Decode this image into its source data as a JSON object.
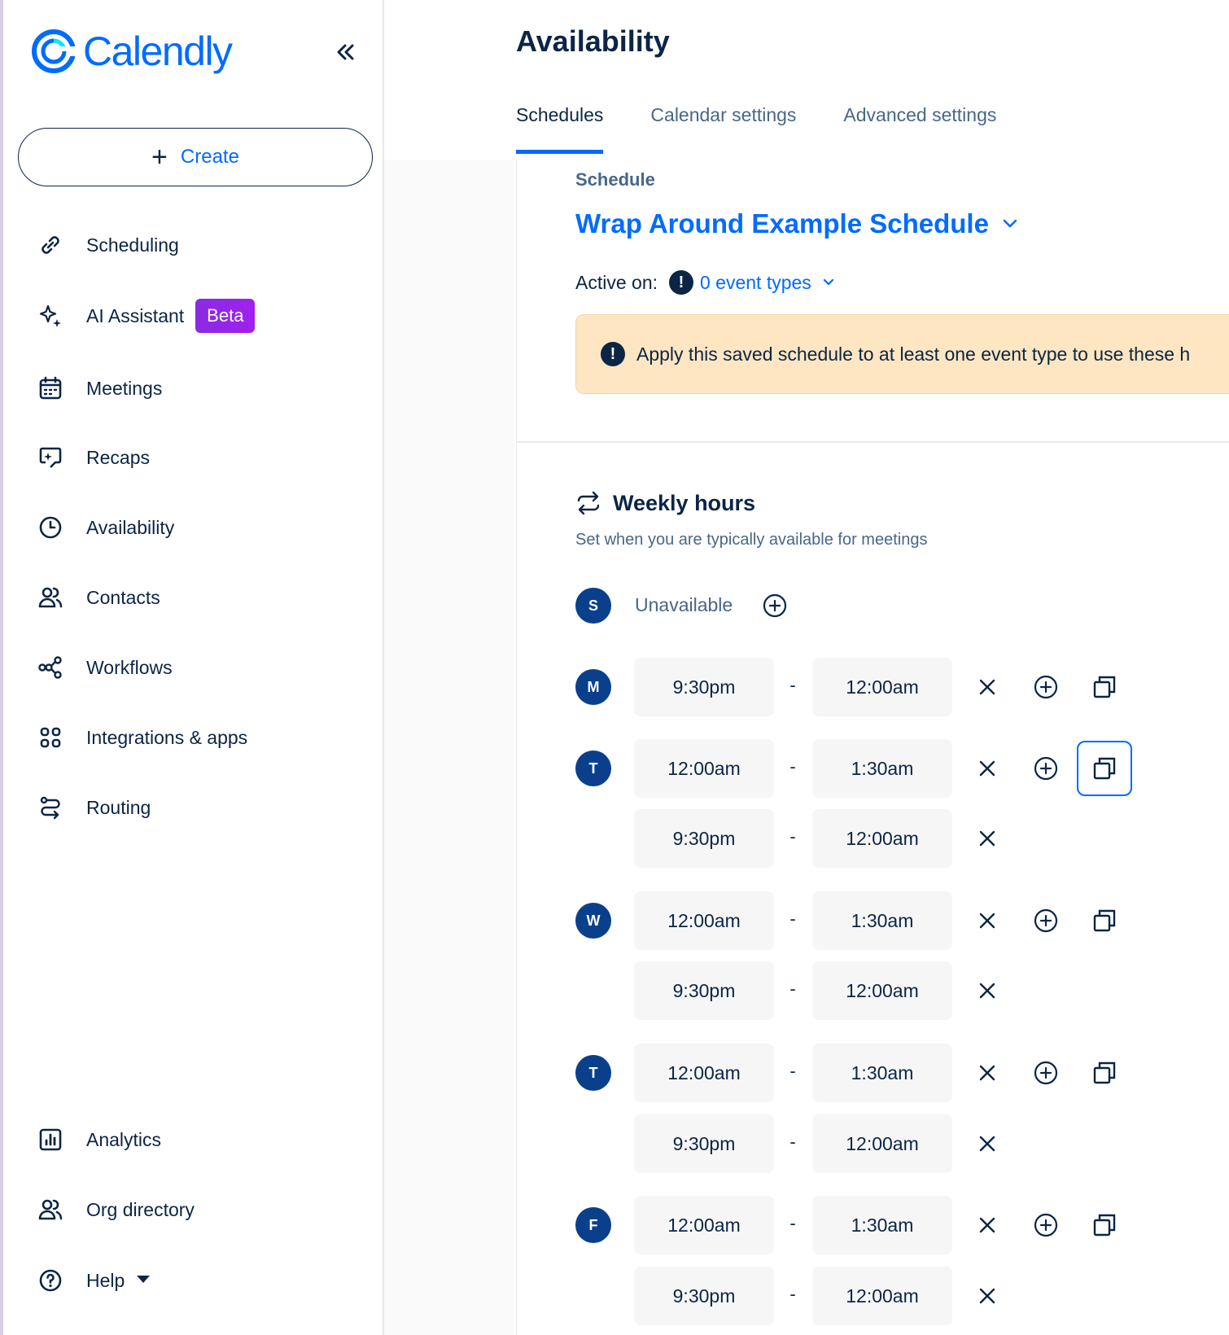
{
  "brand": {
    "name": "Calendly",
    "color": "#006bff"
  },
  "sidebar": {
    "create_label": "Create",
    "items": [
      {
        "label": "Scheduling",
        "icon": "link-icon"
      },
      {
        "label": "AI Assistant",
        "icon": "sparkle-icon",
        "badge": "Beta"
      },
      {
        "label": "Meetings",
        "icon": "calendar-icon"
      },
      {
        "label": "Recaps",
        "icon": "recaps-icon"
      },
      {
        "label": "Availability",
        "icon": "clock-icon"
      },
      {
        "label": "Contacts",
        "icon": "contacts-icon"
      },
      {
        "label": "Workflows",
        "icon": "workflow-icon"
      },
      {
        "label": "Integrations & apps",
        "icon": "apps-grid-icon"
      }
    ],
    "routing_label": "Routing",
    "bottom_items": [
      {
        "label": "Analytics",
        "icon": "chart-icon"
      },
      {
        "label": "Org directory",
        "icon": "org-icon"
      },
      {
        "label": "Help",
        "icon": "help-icon"
      }
    ]
  },
  "main": {
    "title": "Availability",
    "tabs": [
      {
        "label": "Schedules",
        "active": true
      },
      {
        "label": "Calendar settings",
        "active": false
      },
      {
        "label": "Advanced settings",
        "active": false
      }
    ],
    "schedule_label": "Schedule",
    "schedule_name": "Wrap Around Example Schedule",
    "active_on_label": "Active on:",
    "active_on_value": "0 event types",
    "alert_text": "Apply this saved schedule to at least one event type to use these h",
    "weekly_title": "Weekly hours",
    "weekly_subtitle": "Set when you are typically available for meetings",
    "unavailable_label": "Unavailable",
    "separator": "-",
    "days": [
      {
        "letter": "S",
        "slots": []
      },
      {
        "letter": "M",
        "slots": [
          {
            "start": "9:30pm",
            "end": "12:00am"
          }
        ]
      },
      {
        "letter": "T",
        "slots": [
          {
            "start": "12:00am",
            "end": "1:30am"
          },
          {
            "start": "9:30pm",
            "end": "12:00am"
          }
        ]
      },
      {
        "letter": "W",
        "slots": [
          {
            "start": "12:00am",
            "end": "1:30am"
          },
          {
            "start": "9:30pm",
            "end": "12:00am"
          }
        ]
      },
      {
        "letter": "T",
        "slots": [
          {
            "start": "12:00am",
            "end": "1:30am"
          },
          {
            "start": "9:30pm",
            "end": "12:00am"
          }
        ]
      },
      {
        "letter": "F",
        "slots": [
          {
            "start": "12:00am",
            "end": "1:30am"
          },
          {
            "start": "9:30pm",
            "end": "12:00am"
          }
        ]
      }
    ]
  },
  "colors": {
    "accent": "#006bff",
    "navy": "#0b2545",
    "badge": "#0a3f8c",
    "alert_bg": "#fde6c1"
  }
}
